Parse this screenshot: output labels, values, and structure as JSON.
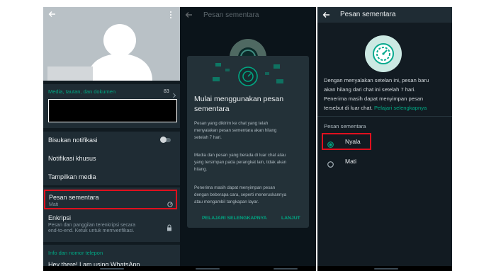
{
  "profile": {
    "media_label": "Media, tautan, dan dokumen",
    "media_count": "83",
    "settings": {
      "silent_notif": "Bisukan notifikasi",
      "custom_notif": "Notifikasi khusus",
      "show_media": "Tampilkan media",
      "disappearing_title": "Pesan sementara",
      "disappearing_value": "Mati",
      "encryption_title": "Enkripsi",
      "encryption_desc_1": "Pesan dan panggilan terenkripsi secara",
      "encryption_desc_2": "end-to-end. Ketuk untuk memverifikasi."
    },
    "info_label": "Info dan nomor telepon",
    "about_text": "Hey there! I am using WhatsApp."
  },
  "dialog": {
    "bg_title": "Pesan sementara",
    "title_1": "Mulai menggunakan pesan",
    "title_2": "sementara",
    "p1_1": "Pesan yang dikirim ke chat yang telah",
    "p1_2": "menyalakan pesan sementara akan hilang",
    "p1_3": "setelah 7 hari.",
    "p2_1": "Media dan pesan yang berada di luar chat atau",
    "p2_2": "yang tersimpan pada perangkat lain, tidak akan",
    "p2_3": "hilang.",
    "p3_1": "Penerima masih dapat menyimpan pesan",
    "p3_2": "dengan beberapa cara, seperti meneruskannya",
    "p3_3": "atau mengambil tangkapan layar.",
    "learn_more": "PELAJARI SELENGKAPNYA",
    "continue": "LANJUT"
  },
  "settings_screen": {
    "title": "Pesan sementara",
    "desc_1": "Dengan menyalakan setelan ini, pesan baru",
    "desc_2": "akan hilang dari chat ini setelah 7 hari.",
    "desc_3": "Penerima masih dapat menyimpan pesan",
    "desc_4": "tersebut di luar chat.",
    "learn_more": "Pelajari selengkapnya",
    "section_label": "Pesan sementara",
    "option_on": "Nyala",
    "option_off": "Mati"
  },
  "colors": {
    "accent": "#00a884",
    "highlight_border": "#e0101e",
    "panel_bg": "#111b21",
    "dialog_bg": "#233138"
  }
}
